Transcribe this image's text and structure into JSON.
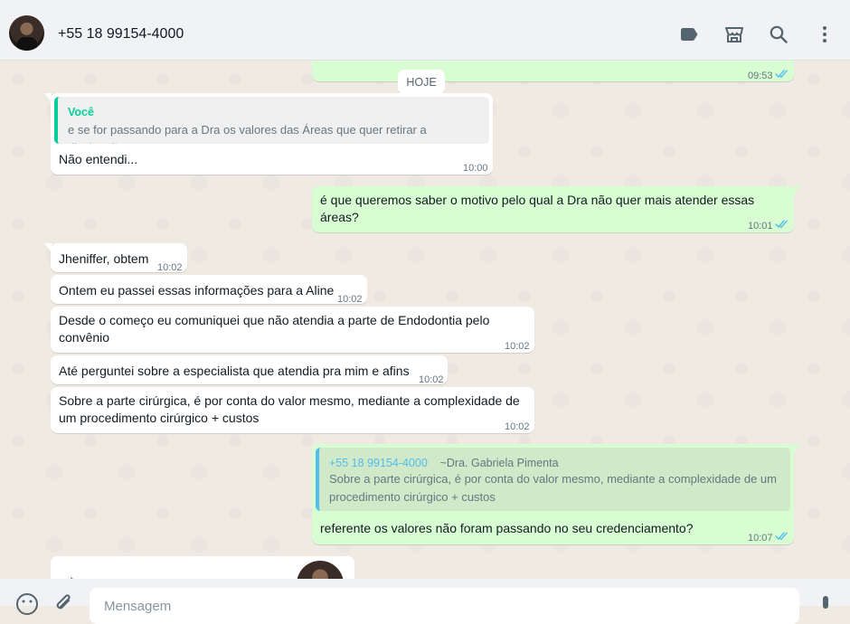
{
  "header": {
    "contact_name": "+55 18 99154-4000"
  },
  "chat": {
    "date_divider": "HOJE",
    "messages": [
      {
        "dir": "out",
        "time": "09:53",
        "ticks": "read"
      },
      {
        "dir": "in",
        "quote_author": "Você",
        "quote_text": "e se for passando para a Dra os valores das Áreas que quer retirar a divulgação",
        "text": "Não entendi...",
        "time": "10:00"
      },
      {
        "dir": "out",
        "text_line1": "é que queremos saber o motivo pelo qual a Dra não quer mais atender essas",
        "text_line2": "áreas?",
        "time": "10:01",
        "ticks": "read"
      },
      {
        "dir": "in",
        "text": "Jheniffer, obtem",
        "time": "10:02"
      },
      {
        "dir": "in",
        "text": "Ontem eu passei essas informações para a Aline",
        "time": "10:02"
      },
      {
        "dir": "in",
        "text_line1": "Desde o começo eu comuniquei que não atendia a parte de Endodontia pelo",
        "text_line2": "convênio",
        "time": "10:02"
      },
      {
        "dir": "in",
        "text": "Até perguntei sobre a especialista que atendia pra mim e afins",
        "time": "10:02"
      },
      {
        "dir": "in",
        "text_line1": "Sobre a parte cirúrgica, é por conta do valor mesmo, mediante a complexidade de",
        "text_line2": "um procedimento cirúrgico + custos",
        "time": "10:02"
      },
      {
        "dir": "out",
        "quote_author": "+55 18 99154-4000",
        "quote_author_sub": "~Dra. Gabriela Pimenta",
        "quote_line1": "Sobre a parte cirúrgica, é por conta do valor mesmo, mediante a complexidade de um",
        "quote_line2": "procedimento cirúrgico + custos",
        "text": "referente os valores não foram passando no seu credenciamento?",
        "time": "10:07",
        "ticks": "read"
      }
    ]
  },
  "composer": {
    "placeholder": "Mensagem"
  },
  "icons": {
    "labels": "label-icon",
    "catalog": "shop-icon",
    "search": "search-icon",
    "menu": "kebab-menu-icon",
    "emoji": "emoji-icon",
    "attach": "paperclip-icon",
    "mic": "mic-icon",
    "scroll": "chevron-down-icon"
  },
  "colors": {
    "incoming": "#ffffff",
    "outgoing": "#d9fdd3",
    "read_ticks": "#53bdeb",
    "quote_accent_in": "#06cf9c",
    "quote_accent_out": "#53bdeb"
  }
}
